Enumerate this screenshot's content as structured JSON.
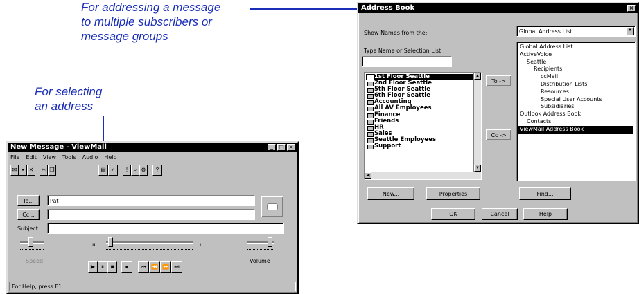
{
  "callouts": {
    "address_book": [
      "For addressing a message",
      "to multiple subscribers or",
      "message groups"
    ],
    "selecting": [
      "For selecting",
      "an address"
    ]
  },
  "address_book": {
    "title": "Address Book",
    "show_names_label": "Show Names from the:",
    "show_names_value": "Global Address List",
    "type_name_label": "Type Name or Selection List",
    "type_name_value": "",
    "names": [
      "1st Floor Seattle",
      "2nd Floor Seattle",
      "5th Floor Seattle",
      "6th Floor Seattle",
      "Accounting",
      "All AV Employees",
      "Finance",
      "Friends",
      "HR",
      "Sales",
      "Seattle Employees",
      "Support"
    ],
    "tree": [
      "Global Address List",
      "ActiveVoice",
      "Seattle",
      "Recipients",
      "ccMail",
      "Distribution Lists",
      "Resources",
      "Special User Accounts",
      "Subsidiaries",
      "Outlook Address Book",
      "Contacts",
      "ViewMail Address Book"
    ],
    "to_button": "To ->",
    "cc_button": "Cc ->",
    "new_button": "New...",
    "properties_button": "Properties",
    "find_button": "Find...",
    "ok_button": "OK",
    "cancel_button": "Cancel",
    "help_button": "Help"
  },
  "new_message": {
    "title": "New Message - ViewMail",
    "menu": [
      "File",
      "Edit",
      "View",
      "Tools",
      "Audio",
      "Help"
    ],
    "to_label": "To...",
    "to_value": "Pat",
    "cc_label": "Cc...",
    "cc_value": "",
    "subject_label": "Subject:",
    "subject_value": "",
    "speed_label": "Speed",
    "volume_label": "Volume",
    "status_text": "For Help, press F1"
  }
}
